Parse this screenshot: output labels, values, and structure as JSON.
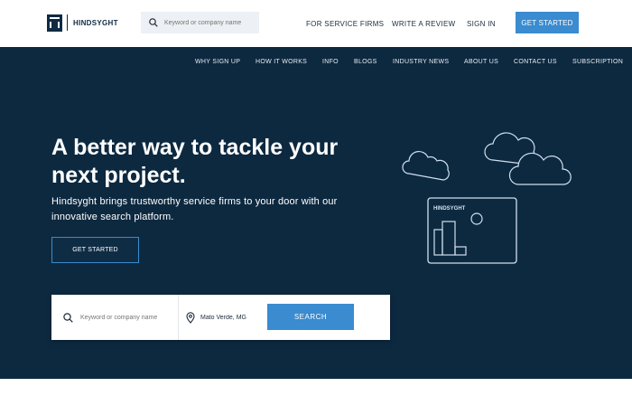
{
  "header": {
    "logo_text": "HINDSYGHT",
    "search_placeholder": "Keyword or company name",
    "nav": [
      {
        "label": "FOR SERVICE FIRMS"
      },
      {
        "label": "WRITE A REVIEW"
      },
      {
        "label": "SIGN IN"
      }
    ],
    "cta_label": "GET STARTED"
  },
  "subnav": [
    {
      "label": "WHY SIGN UP"
    },
    {
      "label": "HOW IT WORKS"
    },
    {
      "label": "INFO"
    },
    {
      "label": "BLOGS"
    },
    {
      "label": "INDUSTRY NEWS"
    },
    {
      "label": "ABOUT US"
    },
    {
      "label": "CONTACT US"
    },
    {
      "label": "SUBSCRIPTION"
    }
  ],
  "hero": {
    "headline": "A better way to tackle your next project.",
    "subtext": "Hindsyght brings trustworthy service firms to your door with our innovative search platform.",
    "cta_label": "GET STARTED",
    "illustration_logo_text": "HINDSYGHT"
  },
  "search": {
    "keyword_placeholder": "Keyword or company name",
    "location_value": "Mato Verde, MG",
    "button_label": "SEARCH"
  },
  "colors": {
    "navy": "#0d2940",
    "accent_blue": "#3a8bcf",
    "white": "#ffffff"
  }
}
